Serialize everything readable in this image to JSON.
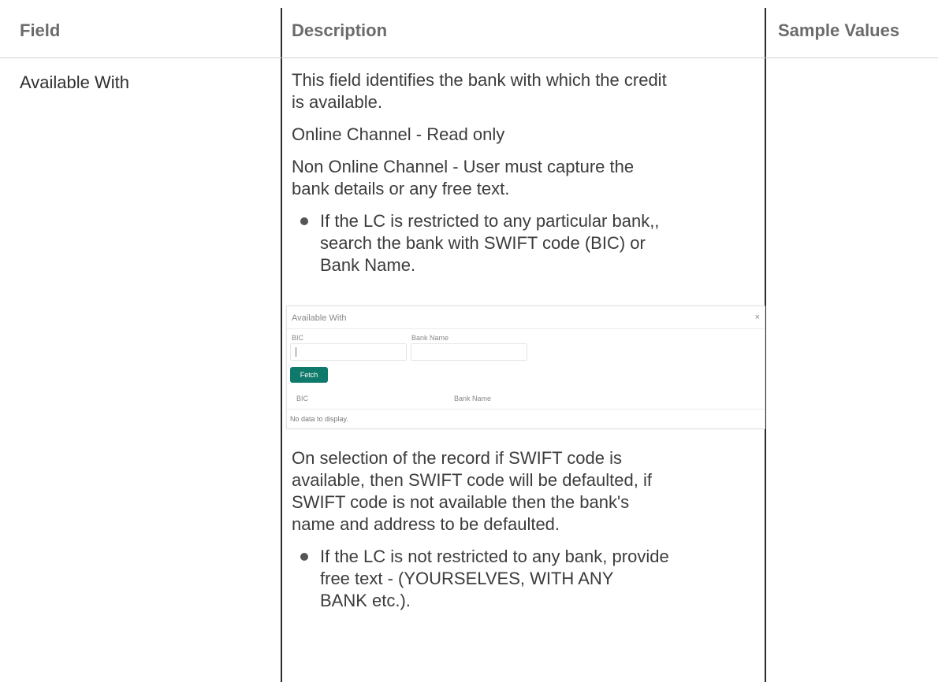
{
  "table": {
    "headers": [
      "Field",
      "Description",
      "Sample Values"
    ],
    "field": "Available With",
    "desc": {
      "p1": [
        "This field identifies the bank with which the credit",
        "is available."
      ],
      "p2": "Online Channel - Read only",
      "p3": [
        "Non Online Channel - User must capture the",
        "bank details or any free text."
      ],
      "b1": [
        "If the LC is restricted to any particular bank,,",
        "search the bank with SWIFT code (BIC) or",
        "Bank Name."
      ],
      "p4": [
        "On selection of the record if SWIFT code is",
        "available, then SWIFT code will be defaulted, if",
        "SWIFT code is not available then the bank's",
        "name and address to be defaulted."
      ],
      "b2": [
        "If the LC is not restricted to any bank, provide",
        "free text - (YOURSELVES, WITH ANY",
        "BANK etc.)."
      ]
    }
  },
  "dialog": {
    "title": "Available With",
    "close": "×",
    "bic_label": "BIC",
    "bank_name_label": "Bank Name",
    "bic_value": "",
    "bank_name_value": "",
    "fetch": "Fetch",
    "col_bic": "BIC",
    "col_bank_name": "Bank Name",
    "no_data": "No data to display."
  }
}
